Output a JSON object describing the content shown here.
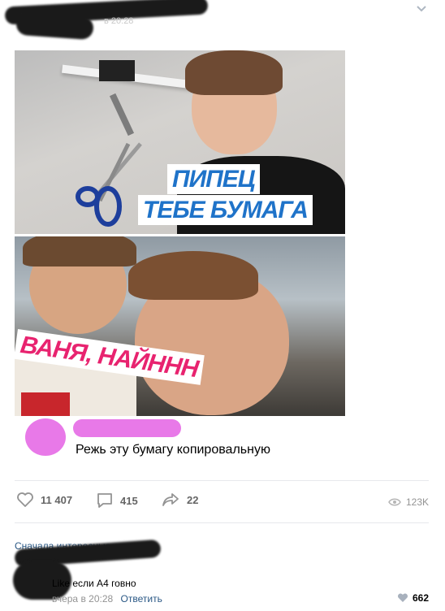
{
  "post": {
    "time_label": "в 20:28",
    "expand_icon": "chevron-down-icon",
    "meme": {
      "caption_top_line1": "ПИПЕЦ",
      "caption_top_line2": "ТЕБЕ БУМАГА",
      "caption_bottom": "ВАНЯ, НАЙННН"
    },
    "comment_caption": "Режь эту бумагу копировальную",
    "actions": {
      "likes": "11 407",
      "comments": "415",
      "shares": "22",
      "views": "123K"
    }
  },
  "comments": {
    "sort_label": "Сначала интересные",
    "items": [
      {
        "text": "Like если А4 говно",
        "time": "вчера в 20:28",
        "reply_label": "Ответить",
        "likes": "662"
      }
    ]
  },
  "colors": {
    "link": "#2a5885",
    "muted": "#939393",
    "censor_pink": "#e879e8",
    "caption_blue": "#1f73c9",
    "caption_pink": "#e8236f"
  }
}
